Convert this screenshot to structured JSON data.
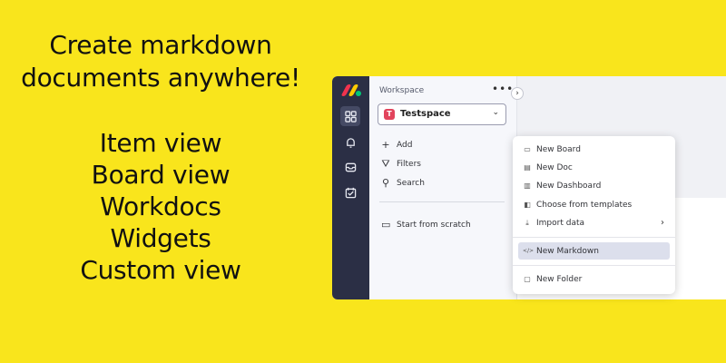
{
  "promo": {
    "headline_line1": "Create markdown",
    "headline_line2": "documents anywhere!",
    "features": [
      "Item view",
      "Board view",
      "Workdocs",
      "Widgets",
      "Custom view"
    ]
  },
  "rail": {
    "icons": [
      "grid-icon",
      "bell-icon",
      "inbox-icon",
      "checkbox-icon"
    ]
  },
  "workspace": {
    "title": "Workspace",
    "more": "•••",
    "selected_initial": "T",
    "selected_name": "Testspace",
    "items": [
      {
        "icon": "+",
        "label": "Add"
      },
      {
        "icon": "⛛",
        "label": "Filters"
      },
      {
        "icon": "⚲",
        "label": "Search"
      }
    ],
    "start_label": "Start from scratch"
  },
  "menu": {
    "items": [
      {
        "icon": "▭",
        "label": "New Board"
      },
      {
        "icon": "▤",
        "label": "New Doc"
      },
      {
        "icon": "▥",
        "label": "New Dashboard"
      },
      {
        "icon": "◧",
        "label": "Choose from templates"
      },
      {
        "icon": "⤓",
        "label": "Import data"
      }
    ],
    "markdown": {
      "icon": "</>",
      "label": "New Markdown"
    },
    "folder": {
      "icon": "▢",
      "label": "New Folder"
    }
  },
  "colors": {
    "background": "#f9e51c",
    "rail": "#2b2f45",
    "workspace_badge": "#e2445c",
    "highlight": "#dcdfec"
  }
}
